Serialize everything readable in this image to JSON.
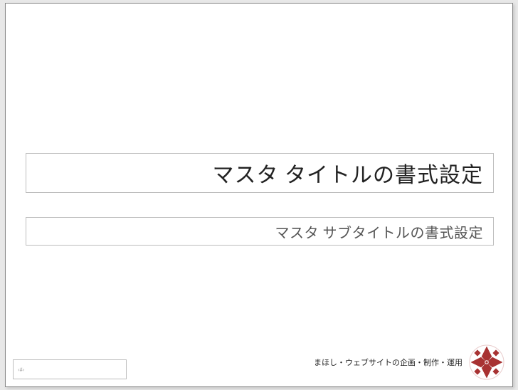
{
  "slide": {
    "title_placeholder": "マスタ タイトルの書式設定",
    "subtitle_placeholder": "マスタ サブタイトルの書式設定",
    "page_number": "‹#›",
    "footer": "まほし・ウェブサイトの企画・制作・運用"
  },
  "colors": {
    "logo_accent": "#a83232"
  }
}
